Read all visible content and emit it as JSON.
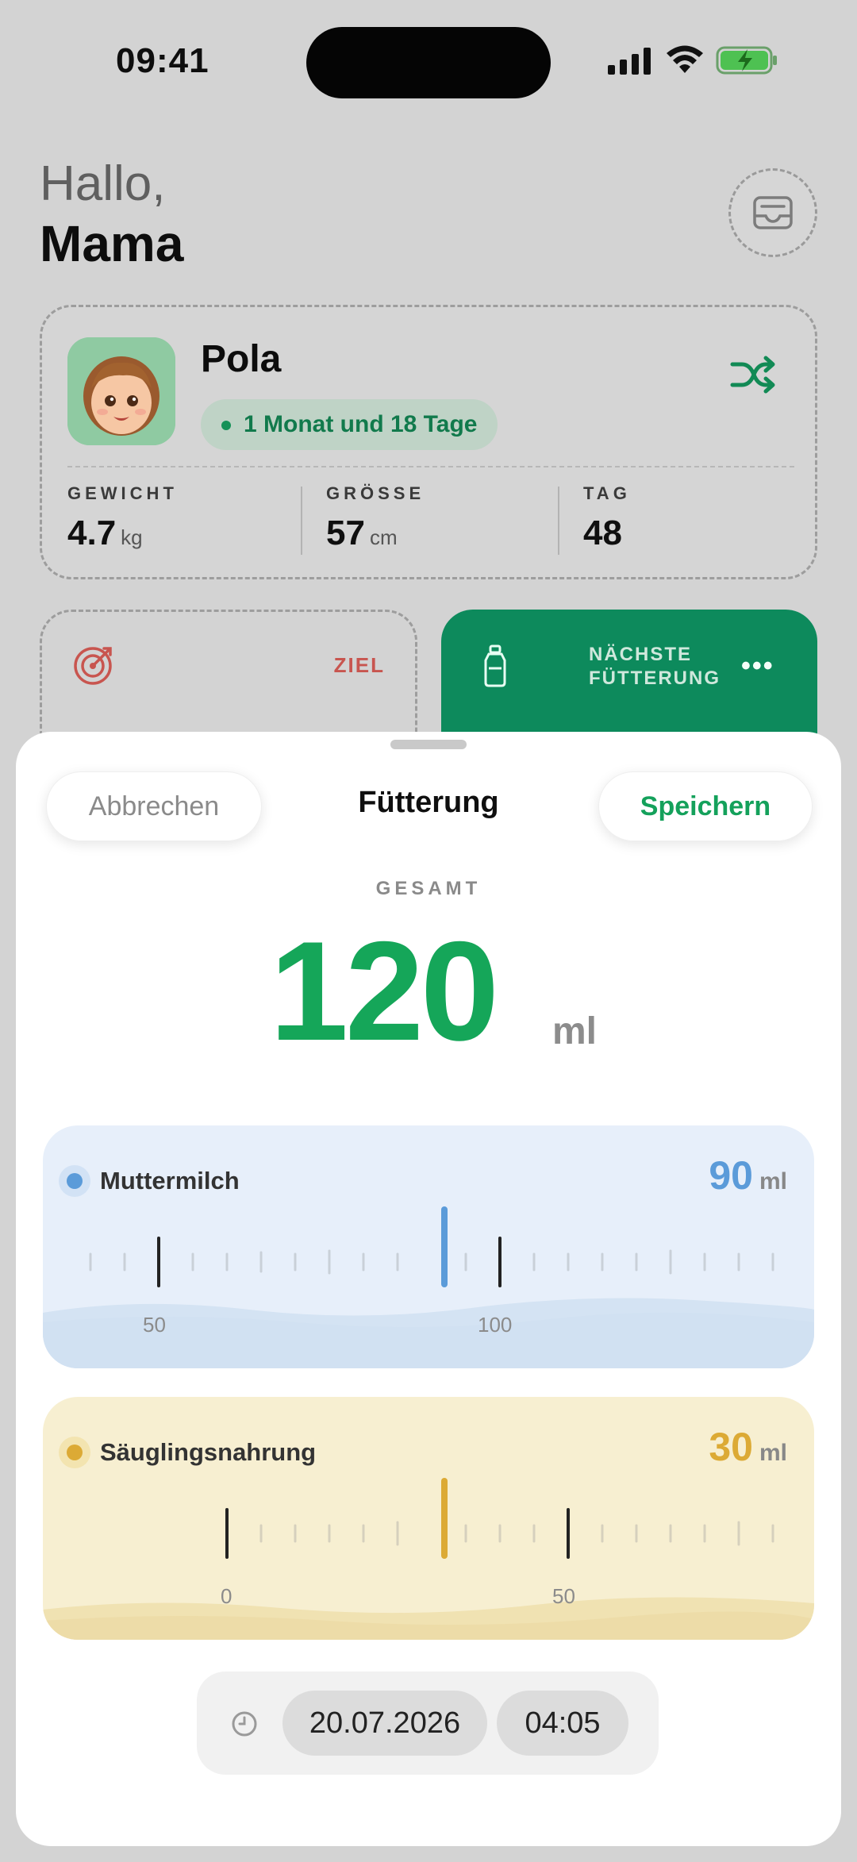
{
  "status": {
    "time": "09:41"
  },
  "greeting": {
    "line1": "Hallo,",
    "line2": "Mama"
  },
  "baby": {
    "name": "Pola",
    "age": "1 Monat und 18 Tage",
    "stats": [
      {
        "label": "GEWICHT",
        "value": "4.7",
        "unit": "kg"
      },
      {
        "label": "GRÖSSE",
        "value": "57",
        "unit": "cm"
      },
      {
        "label": "TAG",
        "value": "48",
        "unit": ""
      }
    ]
  },
  "cards": {
    "goal_label": "ZIEL",
    "next_feeding_line1": "NÄCHSTE",
    "next_feeding_line2": "FÜTTERUNG",
    "more": "•••"
  },
  "sheet": {
    "cancel": "Abbrechen",
    "title": "Fütterung",
    "save": "Speichern",
    "total_label": "GESAMT",
    "total_value": "120",
    "total_unit": "ml"
  },
  "milk": {
    "label": "Muttermilch",
    "value": "90",
    "unit": "ml",
    "color": "#5b9bd9",
    "tick_labels": [
      "50",
      "100"
    ]
  },
  "formula": {
    "label": "Säuglingsnahrung",
    "value": "30",
    "unit": "ml",
    "color": "#dcaa35",
    "tick_labels": [
      "0",
      "50"
    ]
  },
  "datetime": {
    "date": "20.07.2026",
    "time": "04:05",
    "icon": "clock-icon"
  },
  "colors": {
    "accent_green": "#15a659",
    "feed_card": "#0d8a5c",
    "goal_red": "#c8554f"
  }
}
